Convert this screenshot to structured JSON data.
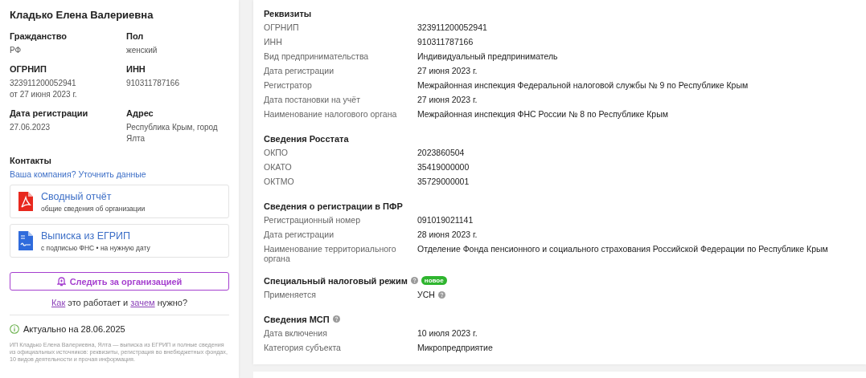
{
  "profile": {
    "name": "Кладько Елена Валериевна",
    "fields": [
      {
        "label": "Гражданство",
        "lines": [
          "РФ"
        ]
      },
      {
        "label": "Пол",
        "lines": [
          "женский"
        ]
      },
      {
        "label": "ОГРНИП",
        "lines": [
          "323911200052941",
          "от 27 июня 2023 г."
        ]
      },
      {
        "label": "ИНН",
        "lines": [
          "910311787166"
        ]
      },
      {
        "label": "Дата регистрации",
        "lines": [
          "27.06.2023"
        ]
      },
      {
        "label": "Адрес",
        "lines": [
          "Республика Крым, город Ялта"
        ]
      }
    ],
    "contacts_title": "Контакты",
    "contacts_link": "Ваша компания? Уточнить данные",
    "documents": [
      {
        "kind": "pdf",
        "title": "Сводный отчёт",
        "subtitle": "общие сведения об организации"
      },
      {
        "kind": "doc",
        "title": "Выписка из ЕГРИП",
        "subtitle": "с подписью ФНС • на нужную дату"
      }
    ],
    "follow_button": "Следить за организацией",
    "how_parts": [
      {
        "kind": "link",
        "text": "Как"
      },
      {
        "kind": "text",
        "text": " это работает и "
      },
      {
        "kind": "link",
        "text": "зачем"
      },
      {
        "kind": "text",
        "text": " нужно?"
      }
    ],
    "actual": "Актуально на 28.06.2025",
    "description": "ИП Кладько Елена Валериевна, Ялта — выписка из ЕГРИП и полные сведения из официальных источников: реквизиты, регистрация во внебюджетных фондах, 10 видов деятельности и прочая информация."
  },
  "sections": [
    {
      "title": "Реквизиты",
      "help": false,
      "rows": [
        {
          "label": "ОГРНИП",
          "value": "323911200052941",
          "help": false
        },
        {
          "label": "ИНН",
          "value": "910311787166",
          "help": false
        },
        {
          "label": "Вид предпринимательства",
          "value": "Индивидуальный предприниматель",
          "help": false
        },
        {
          "label": "Дата регистрации",
          "value": "27 июня 2023 г.",
          "help": false
        },
        {
          "label": "Регистратор",
          "value": "Межрайонная инспекция Федеральной налоговой службы № 9 по Республике Крым",
          "help": false
        },
        {
          "label": "Дата постановки на учёт",
          "value": "27 июня 2023 г.",
          "help": false
        },
        {
          "label": "Наименование налогового органа",
          "value": "Межрайонная инспекция ФНС России № 8 по Республике Крым",
          "help": false
        }
      ]
    },
    {
      "title": "Сведения Росстата",
      "help": false,
      "rows": [
        {
          "label": "ОКПО",
          "value": "2023860504",
          "help": false
        },
        {
          "label": "ОКАТО",
          "value": "35419000000",
          "help": false
        },
        {
          "label": "ОКТМО",
          "value": "35729000001",
          "help": false
        }
      ]
    },
    {
      "title": "Сведения о регистрации в ПФР",
      "help": false,
      "rows": [
        {
          "label": "Регистрационный номер",
          "value": "091019021141",
          "help": false
        },
        {
          "label": "Дата регистрации",
          "value": "28 июня 2023 г.",
          "help": false
        },
        {
          "label": "Наименование территориального органа",
          "value": "Отделение Фонда пенсионного и социального страхования Российской Федерации по Республике Крым",
          "help": false
        }
      ]
    },
    {
      "title": "Специальный налоговый режим",
      "help": true,
      "badge": "новое",
      "rows": [
        {
          "label": "Применяется",
          "value": "УСН",
          "help": true
        }
      ]
    },
    {
      "title": "Сведения МСП",
      "help": true,
      "rows": [
        {
          "label": "Дата включения",
          "value": "10 июля 2023 г.",
          "help": false
        },
        {
          "label": "Категория субъекта",
          "value": "Микропредприятие",
          "help": false
        }
      ]
    }
  ]
}
